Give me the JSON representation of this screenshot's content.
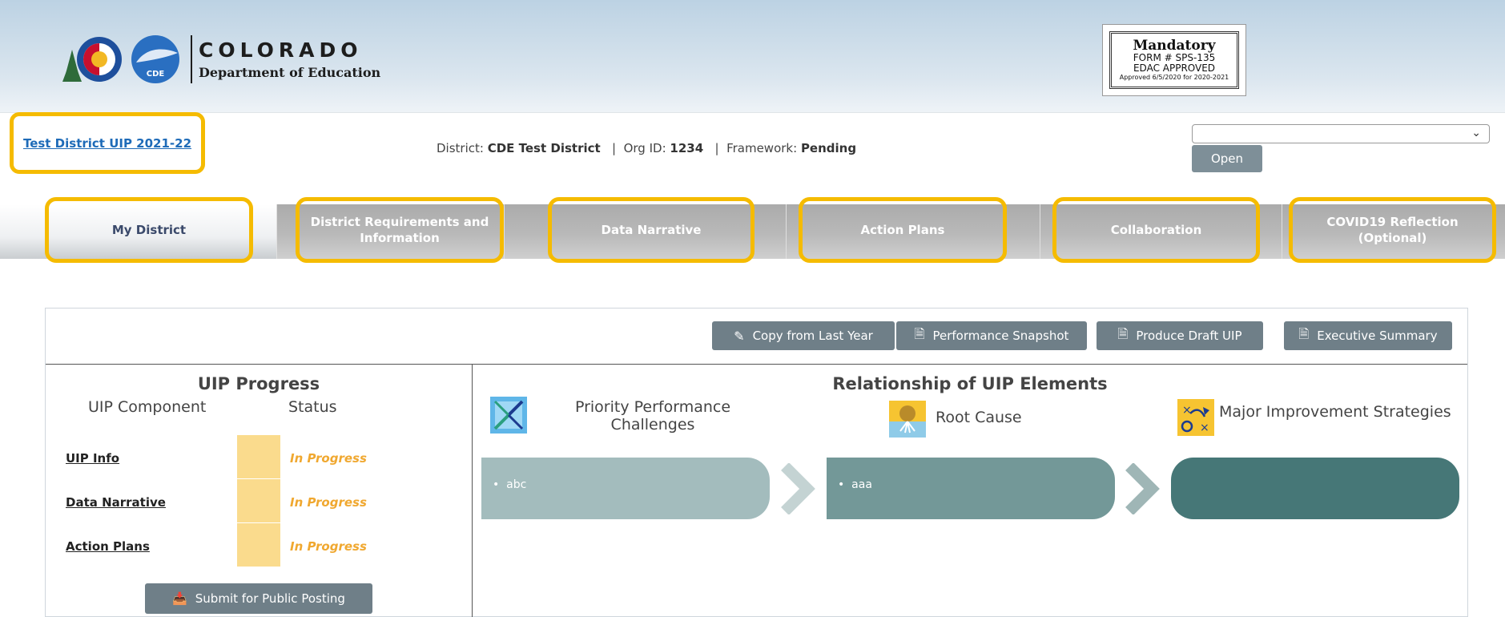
{
  "header": {
    "org_name": "COLORADO",
    "org_sub": "Department of Education",
    "logo_text": "CDE",
    "stamp": {
      "line1": "Mandatory",
      "line2": "FORM # SPS-135",
      "line3": "EDAC APPROVED",
      "line4": "Approved 6/5/2020 for 2020-2021"
    }
  },
  "info_bar": {
    "uip_link": "Test District UIP 2021-22",
    "district_label": "District:",
    "district_value": "CDE Test District",
    "org_label": "Org ID:",
    "org_value": "1234",
    "framework_label": "Framework:",
    "framework_value": "Pending",
    "select_value": "",
    "open_label": "Open"
  },
  "tabs": [
    {
      "label": "My District",
      "active": true
    },
    {
      "label": "District Requirements and Information",
      "active": false
    },
    {
      "label": "Data Narrative",
      "active": false
    },
    {
      "label": "Action Plans",
      "active": false
    },
    {
      "label": "Collaboration",
      "active": false
    },
    {
      "label": "COVID19 Reflection (Optional)",
      "active": false
    }
  ],
  "toolbar": {
    "copy_label": "Copy from Last Year",
    "snapshot_label": "Performance Snapshot",
    "draft_label": "Produce Draft UIP",
    "summary_label": "Executive Summary"
  },
  "progress": {
    "title": "UIP Progress",
    "col_component": "UIP Component",
    "col_status": "Status",
    "rows": [
      {
        "component": "UIP Info",
        "status": "In Progress"
      },
      {
        "component": "Data Narrative",
        "status": "In Progress"
      },
      {
        "component": "Action Plans",
        "status": "In Progress"
      }
    ],
    "submit_label": "Submit for Public Posting"
  },
  "relationship": {
    "title": "Relationship of UIP Elements",
    "columns": [
      {
        "label": "Priority Performance Challenges",
        "items": [
          "abc"
        ],
        "icon": "arrows-expand-icon"
      },
      {
        "label": "Root Cause",
        "items": [
          "aaa"
        ],
        "icon": "root-cause-icon"
      },
      {
        "label": "Major Improvement Strategies",
        "items": [],
        "icon": "strategy-play-icon"
      }
    ]
  },
  "colors": {
    "highlight": "#f5bb00",
    "button": "#6f7f88",
    "status_box": "#fadb8d",
    "status_text": "#f0a830",
    "card1": "#a3bcbd",
    "card2": "#739898",
    "card3": "#467777",
    "link": "#1e6bb8"
  }
}
